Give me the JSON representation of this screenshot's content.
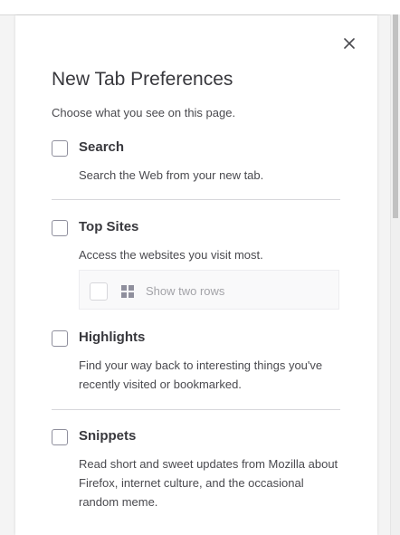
{
  "panel": {
    "title": "New Tab Preferences",
    "subtitle": "Choose what you see on this page."
  },
  "sections": [
    {
      "label": "Search",
      "description": "Search the Web from your new tab.",
      "checked": false
    },
    {
      "label": "Top Sites",
      "description": "Access the websites you visit most.",
      "checked": false
    },
    {
      "label": "Highlights",
      "description": "Find your way back to interesting things you've recently visited or bookmarked.",
      "checked": false
    },
    {
      "label": "Snippets",
      "description": "Read short and sweet updates from Mozilla about Firefox, internet culture, and the occasional random meme.",
      "checked": false
    }
  ],
  "top_sites_rows": {
    "label": "Show two rows",
    "checked": false,
    "disabled": true
  },
  "icons": {
    "close": "close-icon",
    "rows": "grid-icon"
  },
  "colors": {
    "panel_background": "#ffffff",
    "page_background": "#f4f4f4",
    "title_text": "#38383d",
    "body_text": "#4a4a4f",
    "disabled_text": "#a3a3a8",
    "divider": "#d7d7db"
  }
}
